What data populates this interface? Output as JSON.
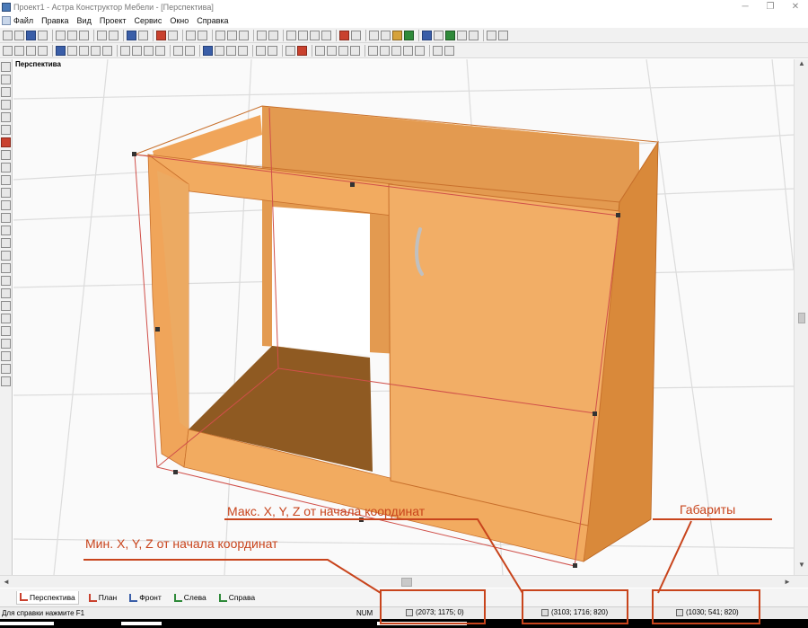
{
  "window": {
    "title": "Проект1 - Астра Конструктор Мебели - [Перспектива]",
    "minimize": "─",
    "restore": "❐",
    "close": "✕"
  },
  "menu": [
    "Файл",
    "Правка",
    "Вид",
    "Проект",
    "Сервис",
    "Окно",
    "Справка"
  ],
  "viewport": {
    "label": "Перспектива"
  },
  "scroll": {
    "up": "▲",
    "down": "▼",
    "left": "◄",
    "right": "►"
  },
  "tabs": [
    {
      "label": "Перспектива",
      "color": "#c9412e"
    },
    {
      "label": "План",
      "color": "#c9412e"
    },
    {
      "label": "Фронт",
      "color": "#3a5ea8"
    },
    {
      "label": "Слева",
      "color": "#2f8a3a"
    },
    {
      "label": "Справа",
      "color": "#2f8a3a"
    }
  ],
  "status": {
    "help": "Для справки нажмите F1",
    "num": "NUM",
    "min_coords": "(2073; 1175; 0)",
    "max_coords": "(3103; 1716; 820)",
    "dimensions": "(1030; 541; 820)"
  },
  "annotations": {
    "min_label": "Мин. X, Y, Z от начала координат",
    "max_label": "Макс. X, Y, Z от начала координат",
    "dim_label": "Габариты",
    "color": "#c8441c"
  },
  "colors": {
    "wood_front": "#f0a55a",
    "wood_light": "#f6b86e",
    "wood_dark": "#d9893a",
    "wood_inside": "#8f5a22",
    "edge": "#b8631f"
  }
}
